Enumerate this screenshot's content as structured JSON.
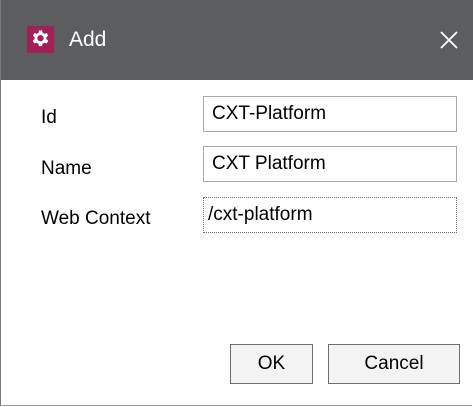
{
  "dialog": {
    "title": "Add",
    "title_icon": "gear-icon",
    "close_icon": "close-icon",
    "titlebar_color": "#5b5d5f",
    "icon_color": "#a21f58"
  },
  "form": {
    "fields": [
      {
        "label": "Id",
        "value": "CXT-Platform"
      },
      {
        "label": "Name",
        "value": "CXT Platform"
      },
      {
        "label": "Web Context",
        "value": "/cxt-platform"
      }
    ]
  },
  "buttons": {
    "ok_label": "OK",
    "cancel_label": "Cancel"
  }
}
